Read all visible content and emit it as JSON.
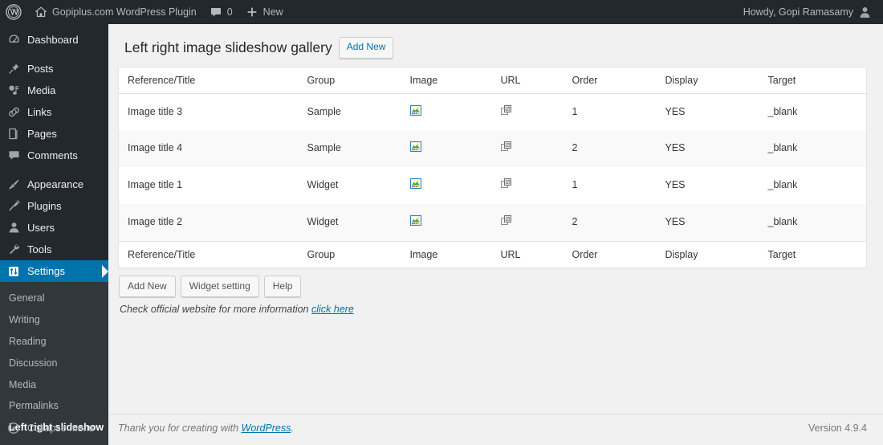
{
  "adminbar": {
    "wp_logo_name": "wordpress-logo-icon",
    "site_name": "Gopiplus.com WordPress Plugin",
    "home_icon": "home-icon",
    "comments_icon": "comment-bubble-icon",
    "comment_count": "0",
    "new_icon": "plus-icon",
    "new_label": "New",
    "howdy": "Howdy, Gopi Ramasamy",
    "avatar_icon": "user-avatar-icon"
  },
  "sidebar": {
    "items": [
      {
        "label": "Dashboard",
        "icon": "dashboard-gauge-icon",
        "key": "dashboard"
      },
      {
        "label": "Posts",
        "icon": "pin-icon",
        "key": "posts"
      },
      {
        "label": "Media",
        "icon": "media-icon",
        "key": "media"
      },
      {
        "label": "Links",
        "icon": "link-chain-icon",
        "key": "links"
      },
      {
        "label": "Pages",
        "icon": "pages-icon",
        "key": "pages"
      },
      {
        "label": "Comments",
        "icon": "comment-bubble-icon",
        "key": "comments"
      },
      {
        "label": "Appearance",
        "icon": "paintbrush-icon",
        "key": "appearance"
      },
      {
        "label": "Plugins",
        "icon": "plug-icon",
        "key": "plugins"
      },
      {
        "label": "Users",
        "icon": "user-icon",
        "key": "users"
      },
      {
        "label": "Tools",
        "icon": "wrench-icon",
        "key": "tools"
      },
      {
        "label": "Settings",
        "icon": "settings-sliders-icon",
        "key": "settings"
      }
    ],
    "submenu": [
      {
        "label": "General",
        "key": "general"
      },
      {
        "label": "Writing",
        "key": "writing"
      },
      {
        "label": "Reading",
        "key": "reading"
      },
      {
        "label": "Discussion",
        "key": "discussion"
      },
      {
        "label": "Media",
        "key": "media"
      },
      {
        "label": "Permalinks",
        "key": "permalinks"
      },
      {
        "label": "Left right slideshow",
        "key": "left-right-slideshow"
      }
    ],
    "collapse_label": "Collapse menu",
    "collapse_icon": "collapse-arrow-icon",
    "active_top": "Settings",
    "active_sub": "Left right slideshow",
    "accent_color": "#0073aa",
    "background_color": "#23282d",
    "submenu_background_color": "#32373c"
  },
  "page": {
    "title": "Left right image slideshow gallery",
    "add_new_label": "Add New"
  },
  "table": {
    "columns": [
      "Reference/Title",
      "Group",
      "Image",
      "URL",
      "Order",
      "Display",
      "Target"
    ],
    "image_icon": "image-thumbnail-icon",
    "url_icon": "external-window-icon",
    "rows": [
      {
        "title": "Image title 3",
        "group": "Sample",
        "order": "1",
        "display": "YES",
        "target": "_blank"
      },
      {
        "title": "Image title 4",
        "group": "Sample",
        "order": "2",
        "display": "YES",
        "target": "_blank"
      },
      {
        "title": "Image title 1",
        "group": "Widget",
        "order": "1",
        "display": "YES",
        "target": "_blank"
      },
      {
        "title": "Image title 2",
        "group": "Widget",
        "order": "2",
        "display": "YES",
        "target": "_blank"
      }
    ]
  },
  "actions": {
    "add_new": "Add New",
    "widget_setting": "Widget setting",
    "help": "Help",
    "note_text": "Check official website for more information",
    "note_link": "click here"
  },
  "footer": {
    "thanks_prefix": "Thank you for creating with ",
    "thanks_link": "WordPress",
    "thanks_suffix": ".",
    "version": "Version 4.9.4"
  }
}
